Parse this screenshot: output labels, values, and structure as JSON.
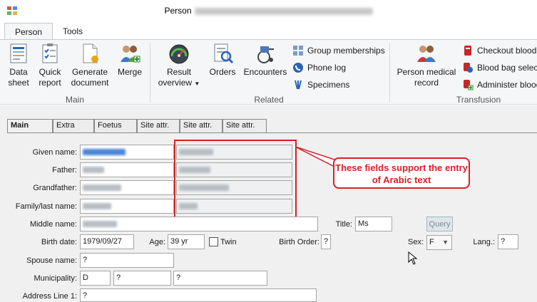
{
  "window": {
    "title_prefix": "Person"
  },
  "ribbon_tabs": [
    {
      "label": "Person",
      "active": true
    },
    {
      "label": "Tools",
      "active": false
    }
  ],
  "ribbon": {
    "main": {
      "group_label": "Main",
      "data_sheet": "Data sheet",
      "quick_report": "Quick report",
      "generate_document": "Generate document",
      "merge": "Merge"
    },
    "related": {
      "group_label": "Related",
      "result_overview": "Result overview",
      "orders": "Orders",
      "encounters": "Encounters",
      "group_memberships": "Group memberships",
      "phone_log": "Phone log",
      "specimens": "Specimens"
    },
    "transfusion": {
      "group_label": "Transfusion",
      "person_medical_record": "Person medical record",
      "checkout_blood": "Checkout blood",
      "blood_bag_select": "Blood bag select",
      "administer_blood": "Administer blood"
    }
  },
  "form_tabs": [
    "Main",
    "Extra",
    "Foetus",
    "Site attr.",
    "Site attr.",
    "Site attr."
  ],
  "form": {
    "given_name_label": "Given name:",
    "father_label": "Father:",
    "grandfather_label": "Grandfather:",
    "family_name_label": "Family/last name:",
    "middle_name_label": "Middle name:",
    "title_label": "Title:",
    "title_value": "Ms",
    "query_button": "Query",
    "birth_date_label": "Birth date:",
    "birth_date_value": "1979/09/27",
    "age_label": "Age:",
    "age_value": "39 yr",
    "twin_label": "Twin",
    "birth_order_label": "Birth Order:",
    "birth_order_value": "?",
    "sex_label": "Sex:",
    "sex_value": "F",
    "lang_label": "Lang.:",
    "lang_value": "?",
    "spouse_name_label": "Spouse name:",
    "spouse_name_value": "?",
    "municipality_label": "Municipality:",
    "municipality_code": "D",
    "municipality_2": "?",
    "municipality_3": "?",
    "address_line1_label": "Address Line 1:",
    "address_line1_value": "?"
  },
  "callout_text": "These fields support the entry of Arabic text",
  "colors": {
    "accent_red": "#d81f26",
    "ribbon_bg": "#f5f6f7",
    "form_bg": "#f0f0f0"
  }
}
